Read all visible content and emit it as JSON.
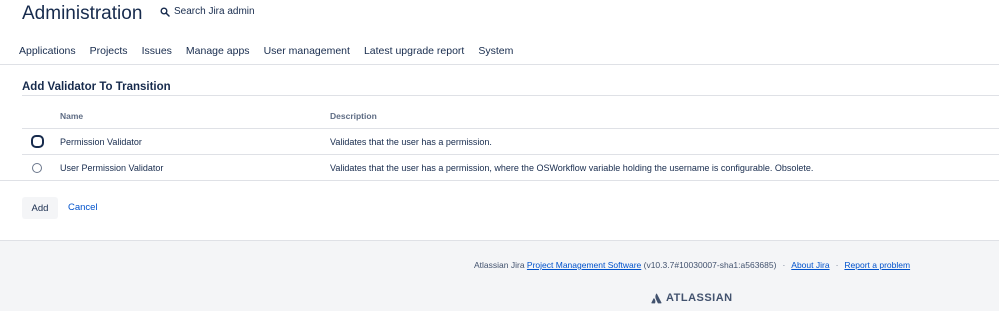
{
  "header": {
    "title": "Administration",
    "search_label": "Search Jira admin",
    "nav": [
      "Applications",
      "Projects",
      "Issues",
      "Manage apps",
      "User management",
      "Latest upgrade report",
      "System"
    ]
  },
  "section": {
    "title": "Add Validator To Transition"
  },
  "table": {
    "columns": {
      "name": "Name",
      "description": "Description"
    },
    "rows": [
      {
        "name": "Permission Validator",
        "description": "Validates that the user has a permission."
      },
      {
        "name": "User Permission Validator",
        "description": "Validates that the user has a permission, where the OSWorkflow variable holding the username is configurable. Obsolete."
      }
    ]
  },
  "actions": {
    "add_label": "Add",
    "cancel_label": "Cancel"
  },
  "footer": {
    "prefix": "Atlassian Jira ",
    "product_link": "Project Management Software",
    "version": " (v10.3.7#10030007-sha1:a563685)",
    "about_link": "About Jira",
    "report_link": "Report a problem",
    "brand": "ATLASSIAN"
  }
}
